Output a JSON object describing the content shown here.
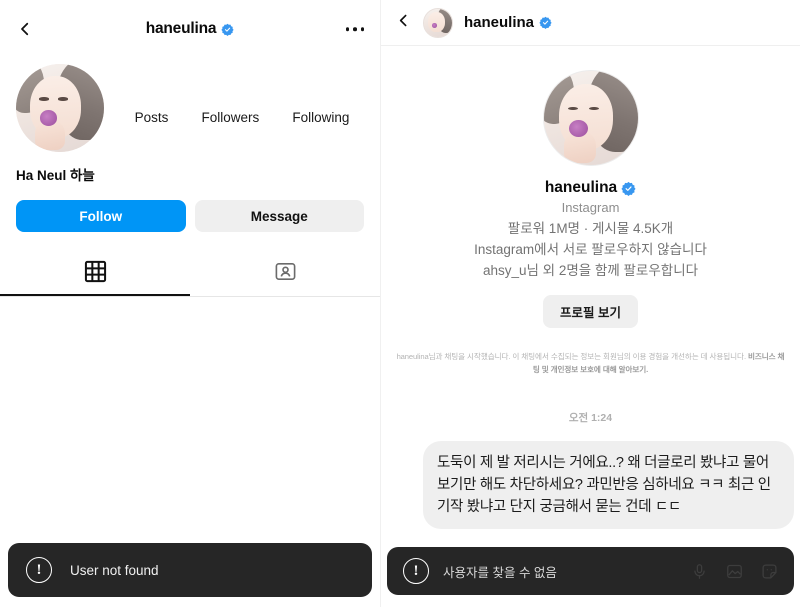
{
  "left_panel": {
    "header": {
      "back_icon": "back-chevron-icon",
      "title": "haneulina",
      "verified_badge": "verified-badge-icon",
      "menu_icon": "more-options-icon"
    },
    "profile": {
      "avatar": "profile-avatar",
      "display_name": "Ha Neul 하늘",
      "stats": [
        {
          "value": "",
          "label": "Posts"
        },
        {
          "value": "",
          "label": "Followers"
        },
        {
          "value": "",
          "label": "Following"
        }
      ]
    },
    "actions": {
      "follow_label": "Follow",
      "message_label": "Message",
      "follow_color": "#0095f6",
      "message_color": "#efefef"
    },
    "tabs": [
      {
        "name": "grid-tab",
        "icon": "grid-icon",
        "active": true
      },
      {
        "name": "tagged-tab",
        "icon": "tagged-person-icon",
        "active": false
      }
    ],
    "toast": {
      "icon": "exclamation-circle-icon",
      "text": "User not found",
      "background": "#262626"
    }
  },
  "right_panel": {
    "header": {
      "back_icon": "back-chevron-icon",
      "avatar": "thread-avatar",
      "title": "haneulina",
      "verified_badge": "verified-badge-icon"
    },
    "profile_card": {
      "avatar": "profile-avatar-large",
      "username": "haneulina",
      "verified_badge": "verified-badge-icon",
      "platform": "Instagram",
      "meta_lines": [
        "팔로워 1M명 · 게시물 4.5K개",
        "Instagram에서 서로 팔로우하지 않습니다",
        "ahsy_u님 외 2명을 함께 팔로우합니다"
      ],
      "view_profile_label": "프로필 보기"
    },
    "disclaimer": {
      "text": "haneulina님과 채팅을 시작했습니다. 이 채팅에서 수집되는 정보는 회원님의 이용 경험을 개선하는 데 사용됩니다. ",
      "link_text": "비즈니스 채팅 및 개인정보 보호에 대해 알아보기."
    },
    "conversation": {
      "timestamp": "오전 1:24",
      "messages": [
        {
          "sender": "me",
          "text": "도둑이 제 발 저리시는 거에요..? 왜 더글로리 봤냐고 물어보기만 해도 차단하세요? 과민반응 심하네요 ㅋㅋ 최근 인기작 봤냐고 단지 궁금해서 묻는 건데 ㄷㄷ"
        }
      ]
    },
    "toast": {
      "icon": "exclamation-circle-icon",
      "text": "사용자를 찾을 수 없음",
      "background": "#262626",
      "actions": [
        {
          "name": "mic-icon"
        },
        {
          "name": "photo-icon"
        },
        {
          "name": "sticker-icon"
        }
      ]
    }
  },
  "theme": {
    "accent_blue": "#0095f6",
    "verified_blue": "#3897f0",
    "toast_bg": "#262626",
    "muted_text": "#8e8e8e"
  }
}
